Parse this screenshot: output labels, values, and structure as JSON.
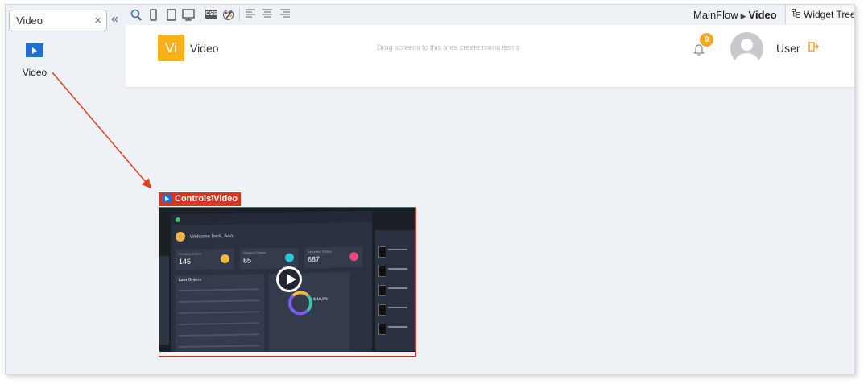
{
  "sidebar": {
    "search": {
      "value": "Video",
      "placeholder": ""
    },
    "clear_symbol": "×",
    "collapse_symbol": "«",
    "widget": {
      "label": "Video",
      "icon": "video-play-icon"
    }
  },
  "toolbar": {
    "icons": [
      "zoom-icon",
      "phone-icon",
      "tablet-icon",
      "desktop-icon",
      "css-icon",
      "theme-palette-icon",
      "align-left-icon",
      "align-center-icon",
      "align-right-icon"
    ],
    "css_label": "CSS",
    "breadcrumb": {
      "parent": "MainFlow",
      "current": "Video"
    },
    "widget_tree_label": "Widget Tree"
  },
  "app": {
    "logo_text": "Vi",
    "title": "Video",
    "menu_hint": "Drag screens to this area create menu items",
    "notification_count": "9",
    "user_name": "User"
  },
  "canvas": {
    "control_tag": "Controls\\Video",
    "video_preview": {
      "welcome": "Welcome back, Ann",
      "stats": [
        {
          "label": "Pending Orders",
          "value": "145"
        },
        {
          "label": "Shipped Orders",
          "value": "65"
        },
        {
          "label": "Returned Orders",
          "value": "687"
        }
      ],
      "orders_title": "Last Orders",
      "donut_value": "$ 18,8%"
    }
  },
  "colors": {
    "accent_red": "#d9351e",
    "logo_yellow": "#f7b21a",
    "badge_orange": "#f5a623",
    "widget_blue": "#1e6fd0"
  }
}
